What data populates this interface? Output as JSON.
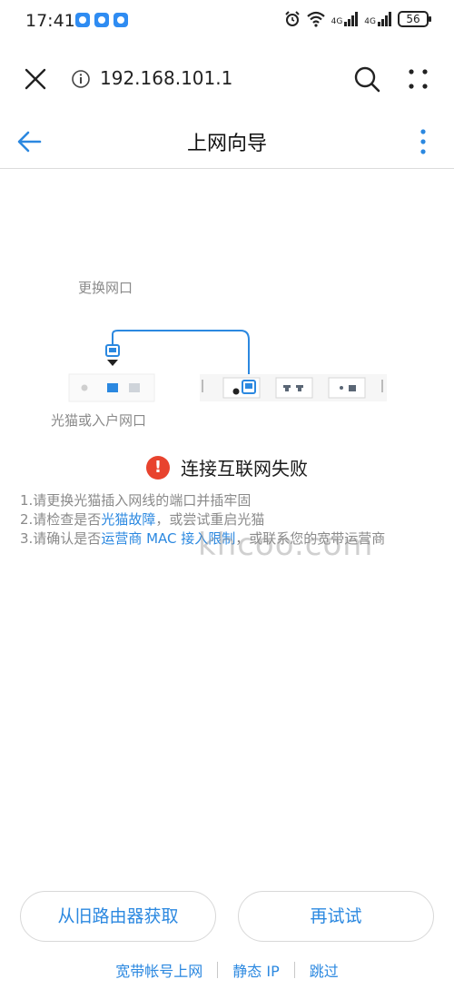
{
  "status_bar": {
    "time": "17:41",
    "battery": "56",
    "network_1": "4G",
    "network_2": "4G"
  },
  "browser": {
    "url": "192.168.101.1"
  },
  "header": {
    "title": "上网向导"
  },
  "diagram": {
    "port_hint": "更换网口",
    "modem_label": "光猫或入户网口"
  },
  "error": {
    "title": "连接互联网失败"
  },
  "tips": {
    "t1": "1.请更换光猫插入网线的端口并插牢固",
    "t2_pre": "2.请检查是否",
    "t2_link": "光猫故障",
    "t2_post": "，或尝试重启光猫",
    "t3_pre": "3.请确认是否",
    "t3_link": "运营商 MAC 接入限制",
    "t3_post": "，或联系您的宽带运营商"
  },
  "watermark": "khcoo.com",
  "buttons": {
    "from_old": "从旧路由器获取",
    "retry": "再试试"
  },
  "footer": {
    "broadband": "宽带帐号上网",
    "static_ip": "静态 IP",
    "skip": "跳过"
  },
  "colors": {
    "accent": "#2b88e0",
    "error": "#e8432e",
    "muted": "#8a8a8a"
  }
}
